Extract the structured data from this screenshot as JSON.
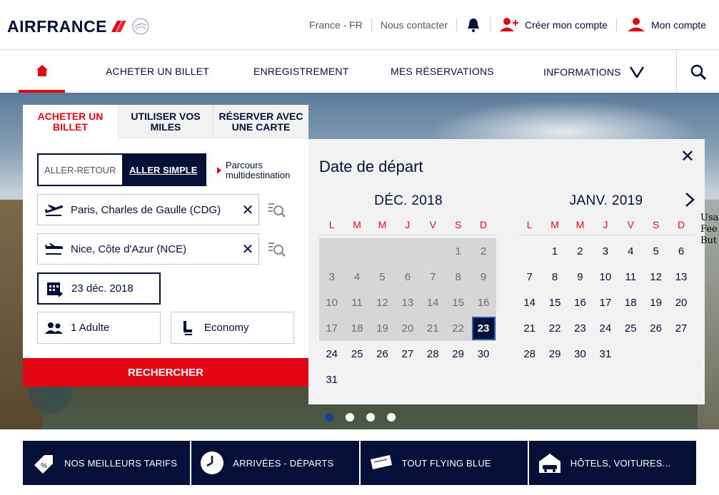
{
  "header": {
    "logo": "AIRFRANCE",
    "country": "France - FR",
    "contact": "Nous contacter",
    "create_account": "Créer mon compte",
    "my_account": "Mon compte"
  },
  "nav": {
    "items": [
      "ACHETER UN BILLET",
      "ENREGISTREMENT",
      "MES RÉSERVATIONS",
      "INFORMATIONS"
    ]
  },
  "booking": {
    "tabs": [
      "ACHETER UN BILLET",
      "UTILISER VOS MILES",
      "RÉSERVER AVEC UNE CARTE"
    ],
    "trip_round": "ALLER-RETOUR",
    "trip_oneway": "ALLER SIMPLE",
    "multi": "Parcours multidestination",
    "origin": "Paris, Charles de Gaulle (CDG)",
    "destination": "Nice, Côte d'Azur (NCE)",
    "date": "23 déc. 2018",
    "passengers": "1 Adulte",
    "cabin": "Economy",
    "search": "RECHERCHER"
  },
  "calendar": {
    "title": "Date de départ",
    "weekdays": [
      "L",
      "M",
      "M",
      "J",
      "V",
      "S",
      "D"
    ],
    "months": [
      {
        "title": "DÉC. 2018",
        "offset": 5,
        "days": 31,
        "past_until": 22,
        "selected": 23
      },
      {
        "title": "JANV. 2019",
        "offset": 1,
        "days": 31,
        "past_until": 0,
        "selected": 0
      }
    ]
  },
  "overflow_text": [
    "Usa",
    "Fee",
    "But"
  ],
  "quick_links": [
    "NOS MEILLEURS TARIFS",
    "ARRIVÉES - DÉPARTS",
    "TOUT FLYING BLUE",
    "HÔTELS, VOITURES..."
  ],
  "colors": {
    "navy": "#051039",
    "red": "#e30613"
  }
}
